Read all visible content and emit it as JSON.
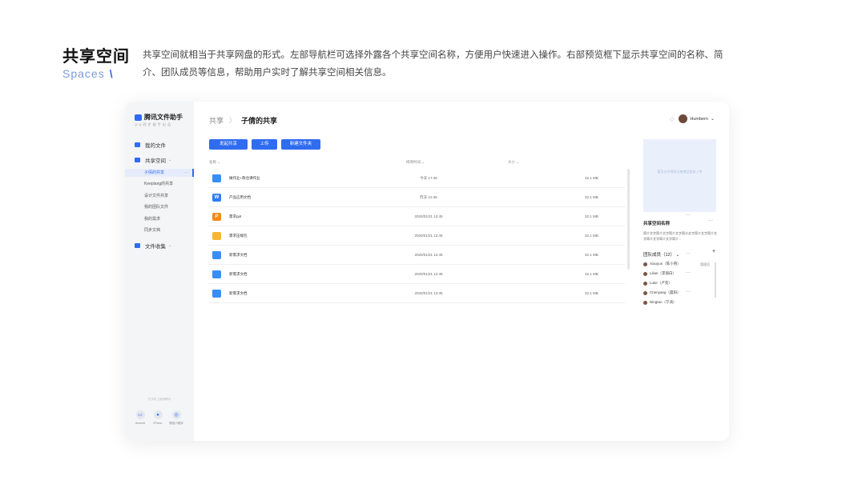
{
  "slide": {
    "title": "共享空间",
    "subtitle": "Spaces",
    "slash": "\\",
    "description": "共享空间就相当于共享网盘的形式。左部导航栏可选择外露各个共享空间名称，方便用户快速进入操作。右部预览框下显示共享空间的名称、简介、团队成员等信息，帮助用户实时了解共享空间相关信息。"
  },
  "app": {
    "logo_text": "腾讯文件助手",
    "logo_sub": "Q Q 同 步 助 手 出 品",
    "sidebar": {
      "my_files": "我的文件",
      "shared_space": "共享空间",
      "shared_items": [
        "子倩的共享",
        "Keeplang的共享",
        "设计文件共享",
        "我的团队文件",
        "我的需求",
        "同步文档"
      ],
      "more_dots": "···",
      "file_collect": "文件收集",
      "footer_text": "在手机上使用腾讯",
      "platforms": [
        {
          "label": "Android",
          "icon": "android-icon"
        },
        {
          "label": "iPhone",
          "icon": "apple-icon"
        },
        {
          "label": "微信小程序",
          "icon": "wechat-icon"
        }
      ]
    },
    "breadcrumb": {
      "root": "共享",
      "separator": "〉",
      "current": "子倩的共享"
    },
    "user": {
      "name": "Humbern",
      "caret": "⌄",
      "gem": "◇"
    },
    "toolbar": {
      "share": "发起共享",
      "upload": "上传",
      "new_folder": "新建文件夹"
    },
    "table": {
      "headers": {
        "name": "名称 ⌄",
        "modified": "修改时间 ⌄",
        "size": "大小 ⌄"
      },
      "rows": [
        {
          "type": "folder",
          "icon": "",
          "name": "做作业+政治课作业",
          "date": "今天 17:45",
          "size": "32.1 MB",
          "more": "···"
        },
        {
          "type": "word",
          "icon": "W",
          "name": "产品应用文档",
          "date": "昨天 12:45",
          "size": "32.1 MB",
          "more": "···"
        },
        {
          "type": "ppt",
          "icon": "P",
          "name": "需求ppt",
          "date": "2020/01/21 12:45",
          "size": "32.1 MB",
          "more": "···"
        },
        {
          "type": "zip",
          "icon": "",
          "name": "需求压缩包",
          "date": "2020/01/21 12:45",
          "size": "32.1 MB",
          "more": "···"
        },
        {
          "type": "folder",
          "icon": "",
          "name": "新需求文档",
          "date": "2020/01/21 12:45",
          "size": "32.1 MB",
          "more": "···"
        },
        {
          "type": "folder",
          "icon": "",
          "name": "新需求文档",
          "date": "2020/01/21 12:45",
          "size": "32.1 MB",
          "more": "···"
        },
        {
          "type": "folder",
          "icon": "",
          "name": "新需求文档",
          "date": "2020/01/21 12:45",
          "size": "32.1 MB",
          "more": "···"
        }
      ]
    },
    "panel": {
      "preview_text": "暂无文件预览可拖拽至此处上传",
      "space_name": "共享空间名称",
      "more": "···",
      "space_desc": "简介文字简介文字简介文字简介文字简介文字简介文字简介文字简介文字简介...",
      "team_title": "团队成员（12）",
      "team_caret": "⌄",
      "add": "+",
      "members": [
        {
          "name": "Xiaoyun（陈小燕）",
          "role": "管理员"
        },
        {
          "name": "Lilian（李丽白）",
          "role": ""
        },
        {
          "name": "Luke（卢克）",
          "role": ""
        },
        {
          "name": "Chenyang（晨阳）",
          "role": ""
        },
        {
          "name": "Ningtao（宁涛）",
          "role": ""
        }
      ]
    }
  },
  "colors": {
    "accent": "#2f6cf0",
    "sidebar_bg": "#f4f5f7",
    "active_bg": "#e6ecfb",
    "preview_bg": "#eaf0fb"
  }
}
